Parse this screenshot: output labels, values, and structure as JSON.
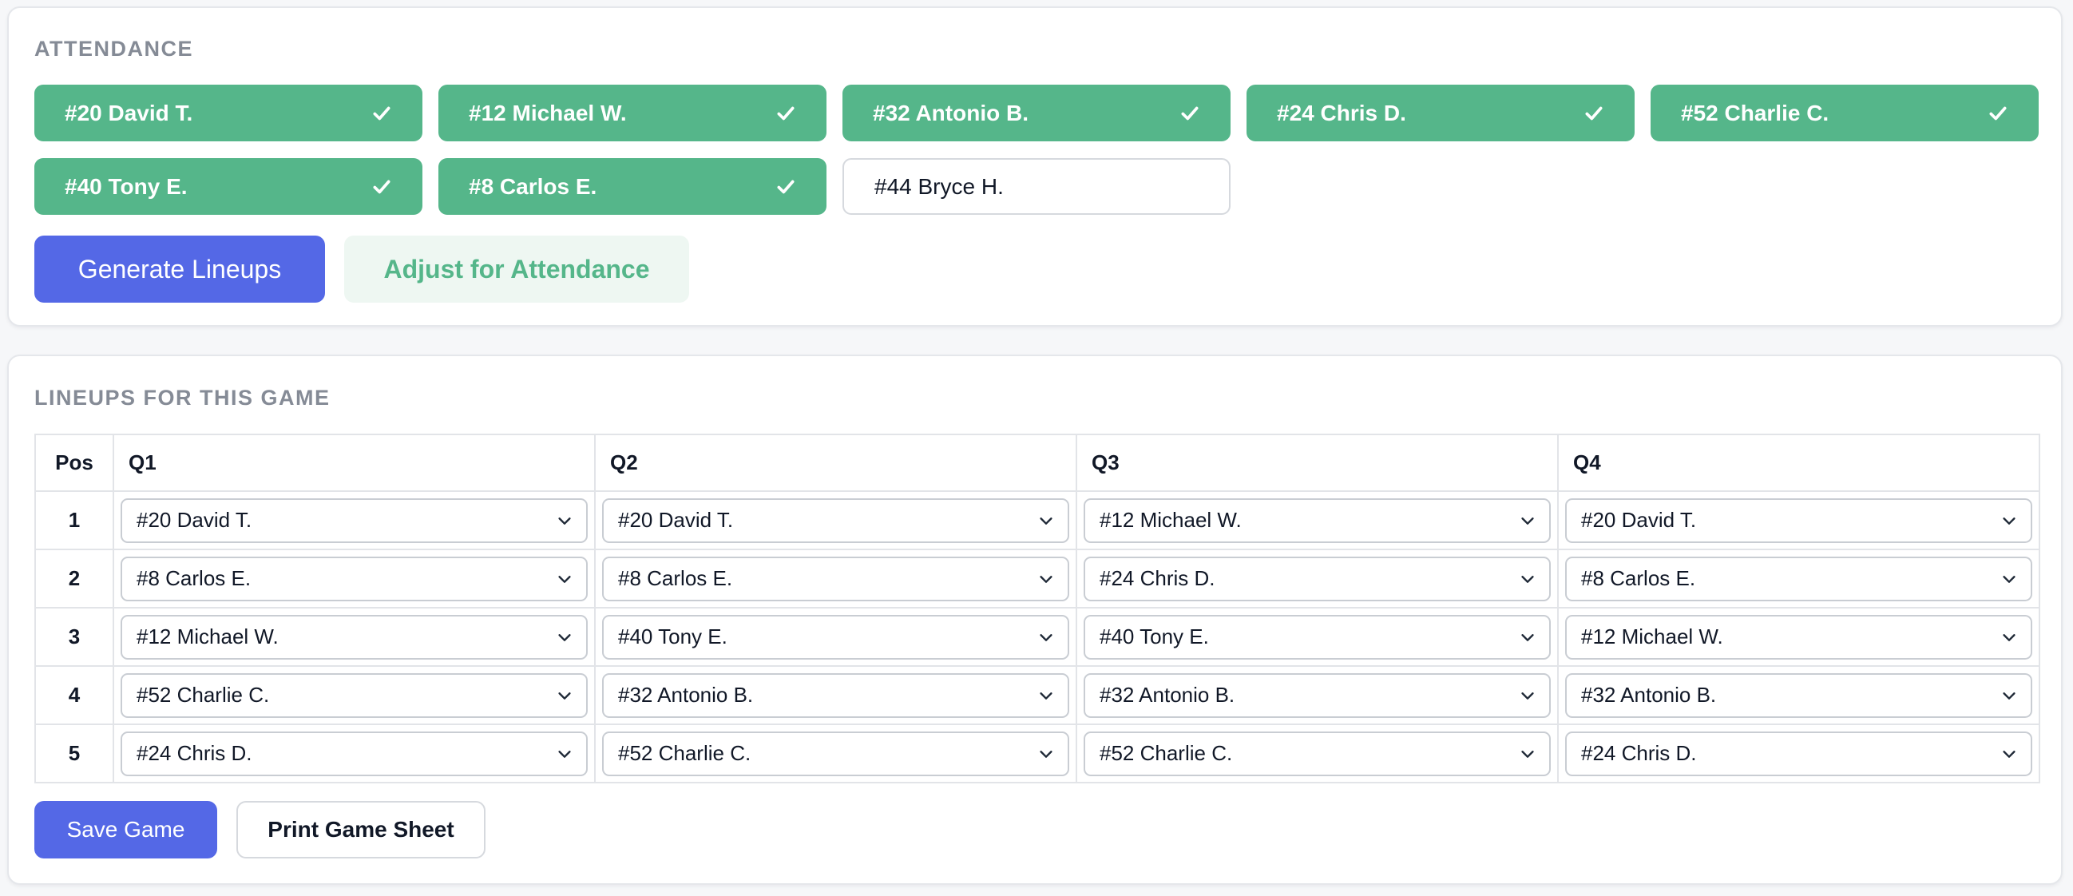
{
  "attendance": {
    "title": "ATTENDANCE",
    "players": [
      {
        "label": "#20 David T.",
        "present": true
      },
      {
        "label": "#12 Michael W.",
        "present": true
      },
      {
        "label": "#32 Antonio B.",
        "present": true
      },
      {
        "label": "#24 Chris D.",
        "present": true
      },
      {
        "label": "#52 Charlie C.",
        "present": true
      },
      {
        "label": "#40 Tony E.",
        "present": true
      },
      {
        "label": "#8 Carlos E.",
        "present": true
      },
      {
        "label": "#44 Bryce H.",
        "present": false
      }
    ],
    "generate_label": "Generate Lineups",
    "adjust_label": "Adjust for Attendance"
  },
  "lineups": {
    "title": "LINEUPS FOR THIS GAME",
    "columns": [
      "Pos",
      "Q1",
      "Q2",
      "Q3",
      "Q4"
    ],
    "rows": [
      {
        "pos": "1",
        "q": [
          "#20 David T.",
          "#20 David T.",
          "#12 Michael W.",
          "#20 David T."
        ]
      },
      {
        "pos": "2",
        "q": [
          "#8 Carlos E.",
          "#8 Carlos E.",
          "#24 Chris D.",
          "#8 Carlos E."
        ]
      },
      {
        "pos": "3",
        "q": [
          "#12 Michael W.",
          "#40 Tony E.",
          "#40 Tony E.",
          "#12 Michael W."
        ]
      },
      {
        "pos": "4",
        "q": [
          "#52 Charlie C.",
          "#32 Antonio B.",
          "#32 Antonio B.",
          "#32 Antonio B."
        ]
      },
      {
        "pos": "5",
        "q": [
          "#24 Chris D.",
          "#52 Charlie C.",
          "#52 Charlie C.",
          "#24 Chris D."
        ]
      }
    ],
    "save_label": "Save Game",
    "print_label": "Print Game Sheet"
  },
  "colors": {
    "present": "#55b68a",
    "primary": "#5468e6",
    "soft": "#eef7f2",
    "muted": "#858b96"
  },
  "icons": {
    "present_marker": "check-icon",
    "select_marker": "chevron-down-icon"
  }
}
